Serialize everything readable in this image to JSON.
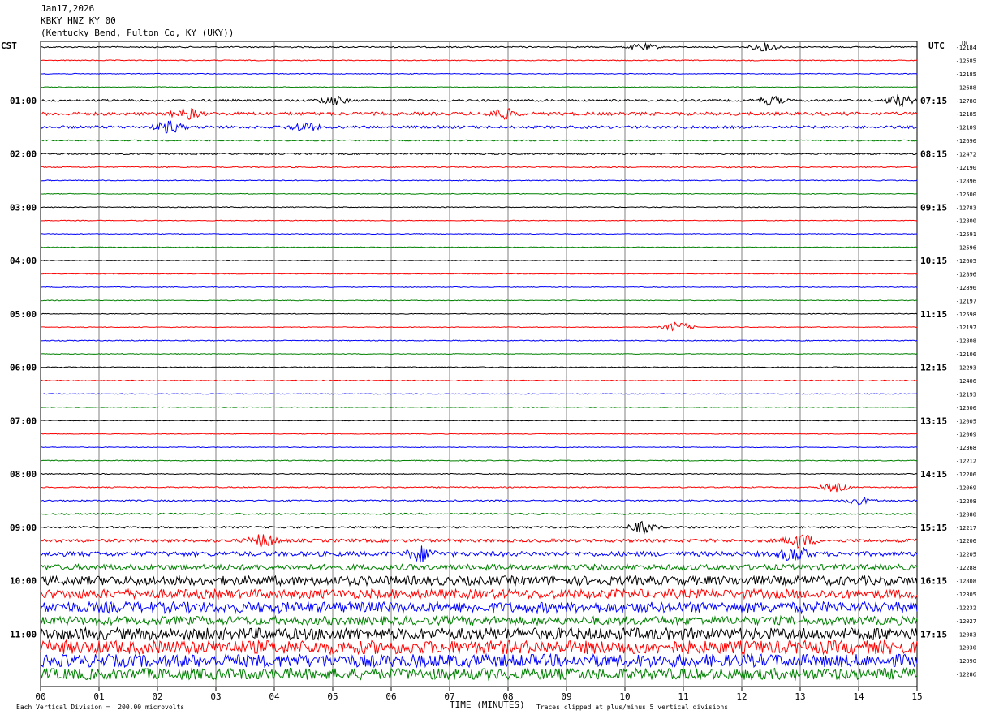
{
  "header": {
    "date": "Jan17,2026",
    "station": "KBKY HNZ KY 00",
    "location": "(Kentucky Bend, Fulton Co, KY (UKY))"
  },
  "left_zone": "CST",
  "right_zone": "UTC",
  "dc_label": "DC",
  "chart_data": {
    "type": "line",
    "subtype": "helicorder",
    "xlabel": "TIME (MINUTES)",
    "x_ticks": [
      "00",
      "01",
      "02",
      "03",
      "04",
      "05",
      "06",
      "07",
      "08",
      "09",
      "10",
      "11",
      "12",
      "13",
      "14",
      "15"
    ],
    "xlim": [
      0,
      15
    ],
    "left_hour_labels": [
      "01:00",
      "02:00",
      "03:00",
      "04:00",
      "05:00",
      "06:00",
      "07:00",
      "08:00",
      "09:00",
      "10:00",
      "11:00"
    ],
    "right_hour_labels": [
      "07:15",
      "08:15",
      "09:15",
      "10:15",
      "11:15",
      "12:15",
      "13:15",
      "14:15",
      "15:15",
      "16:15",
      "17:15"
    ],
    "trace_colors": [
      "#000000",
      "#ff0000",
      "#0000ff",
      "#008000"
    ],
    "dc_offsets": [
      "-12184",
      "-12585",
      "-12185",
      "-12688",
      "-12780",
      "-12185",
      "-12109",
      "-12690",
      "-12472",
      "-12190",
      "-12896",
      "-12500",
      "-12783",
      "-12800",
      "-12591",
      "-12596",
      "-12605",
      "-12896",
      "-12896",
      "-12197",
      "-12598",
      "-12197",
      "-12808",
      "-12106",
      "-12293",
      "-12406",
      "-12193",
      "-12500",
      "-12005",
      "-12069",
      "-12368",
      "-12212",
      "-12206",
      "-12069",
      "-12208",
      "-12080",
      "-12217",
      "-12206",
      "-12205",
      "-12288",
      "-12808",
      "-12305",
      "-12232",
      "-12027",
      "-12083",
      "-12030",
      "-12090",
      "-12286"
    ],
    "activity": [
      [
        0.35,
        0.25,
        0.22,
        0.2,
        0.6,
        0.9,
        0.75,
        0.35,
        0.45,
        0.3,
        0.25,
        0.2,
        0.22,
        0.2,
        0.2,
        0.2,
        0.2,
        0.2,
        0.2,
        0.2,
        0.2,
        0.2,
        0.25,
        0.2,
        0.25,
        0.25,
        0.2,
        0.2,
        0.2,
        0.2,
        0.2,
        0.25,
        0.25,
        0.3,
        0.4,
        0.45,
        0.55,
        0.9,
        1.3,
        1.6,
        2.6,
        2.6,
        3.0,
        2.4,
        3.4,
        3.8,
        3.6,
        3.2
      ]
    ],
    "events": [
      {
        "trace": 0,
        "minute": 10.3,
        "amp": 2.0
      },
      {
        "trace": 0,
        "minute": 12.4,
        "amp": 2.2
      },
      {
        "trace": 4,
        "minute": 5.0,
        "amp": 2.5
      },
      {
        "trace": 4,
        "minute": 12.5,
        "amp": 2.5
      },
      {
        "trace": 4,
        "minute": 14.7,
        "amp": 3.0
      },
      {
        "trace": 5,
        "minute": 2.5,
        "amp": 3.0
      },
      {
        "trace": 5,
        "minute": 7.9,
        "amp": 3.0
      },
      {
        "trace": 6,
        "minute": 2.2,
        "amp": 3.5
      },
      {
        "trace": 6,
        "minute": 4.5,
        "amp": 2.5
      },
      {
        "trace": 21,
        "minute": 10.9,
        "amp": 3.0
      },
      {
        "trace": 33,
        "minute": 13.6,
        "amp": 2.5
      },
      {
        "trace": 34,
        "minute": 14.0,
        "amp": 2.0
      },
      {
        "trace": 36,
        "minute": 10.3,
        "amp": 3.0
      },
      {
        "trace": 37,
        "minute": 3.8,
        "amp": 3.5
      },
      {
        "trace": 37,
        "minute": 13.0,
        "amp": 4.0
      },
      {
        "trace": 38,
        "minute": 6.5,
        "amp": 4.0
      },
      {
        "trace": 38,
        "minute": 12.9,
        "amp": 4.0
      }
    ]
  },
  "footer": {
    "scale_note": "Each Vertical Division =  200.00 microvolts",
    "clip_note": "Traces clipped at plus/minus 5 vertical divisions"
  }
}
